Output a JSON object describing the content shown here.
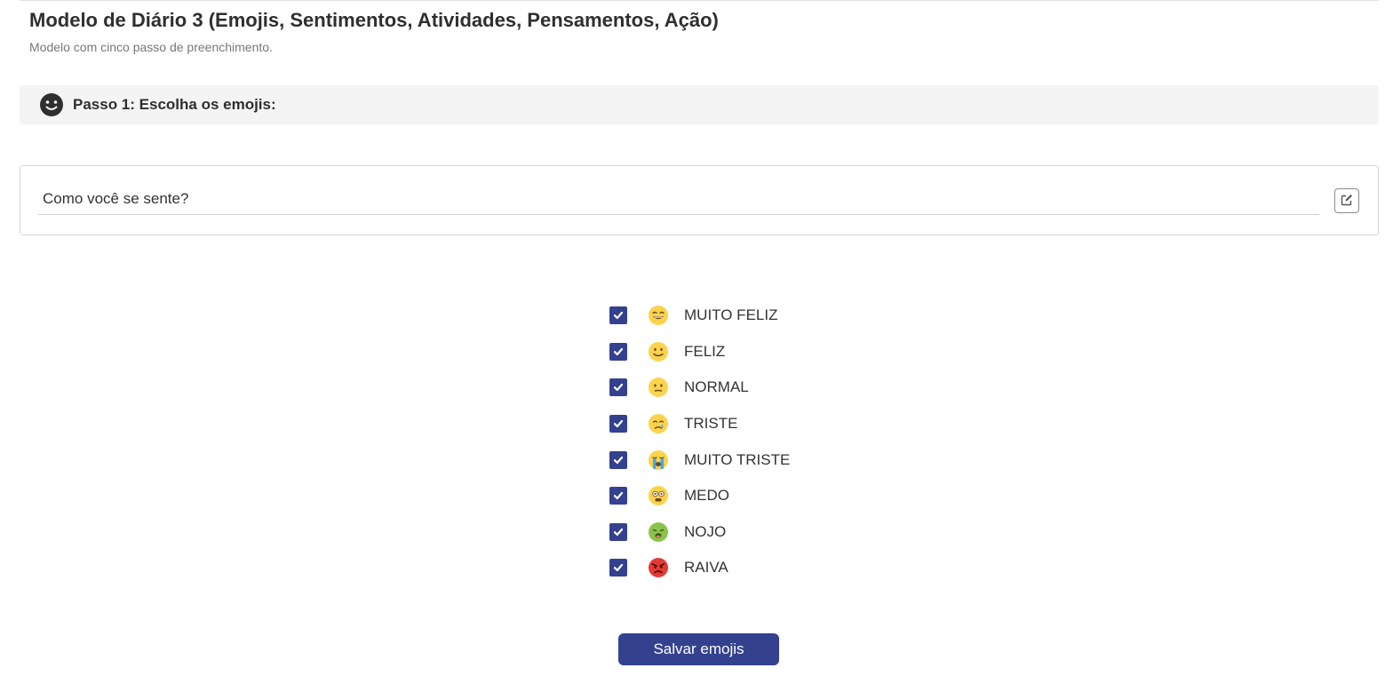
{
  "page": {
    "title": "Modelo de Diário 3 (Emojis, Sentimentos, Atividades, Pensamentos, Ação)",
    "subtitle": "Modelo com cinco passo de preenchimento."
  },
  "step": {
    "title": "Passo 1: Escolha os emojis:",
    "icon": "smiley-face-icon"
  },
  "question": {
    "value": "Como você se sente?",
    "edit_icon": "edit-icon"
  },
  "emojis": [
    {
      "label": "MUITO FELIZ",
      "checked": true,
      "icon": "grinning-face-icon"
    },
    {
      "label": "FELIZ",
      "checked": true,
      "icon": "smiling-face-icon"
    },
    {
      "label": "NORMAL",
      "checked": true,
      "icon": "neutral-face-icon"
    },
    {
      "label": "TRISTE",
      "checked": true,
      "icon": "crying-face-icon"
    },
    {
      "label": "MUITO TRISTE",
      "checked": true,
      "icon": "loudly-crying-face-icon"
    },
    {
      "label": "MEDO",
      "checked": true,
      "icon": "fearful-face-icon"
    },
    {
      "label": "NOJO",
      "checked": true,
      "icon": "nauseated-face-icon"
    },
    {
      "label": "RAIVA",
      "checked": true,
      "icon": "angry-face-icon"
    }
  ],
  "actions": {
    "save_label": "Salvar emojis"
  },
  "colors": {
    "primary": "#33418f",
    "header_bg": "#f4f4f4",
    "emoji_yellow": "#fcd34d",
    "emoji_green": "#8bc34a",
    "emoji_red": "#e53935"
  }
}
